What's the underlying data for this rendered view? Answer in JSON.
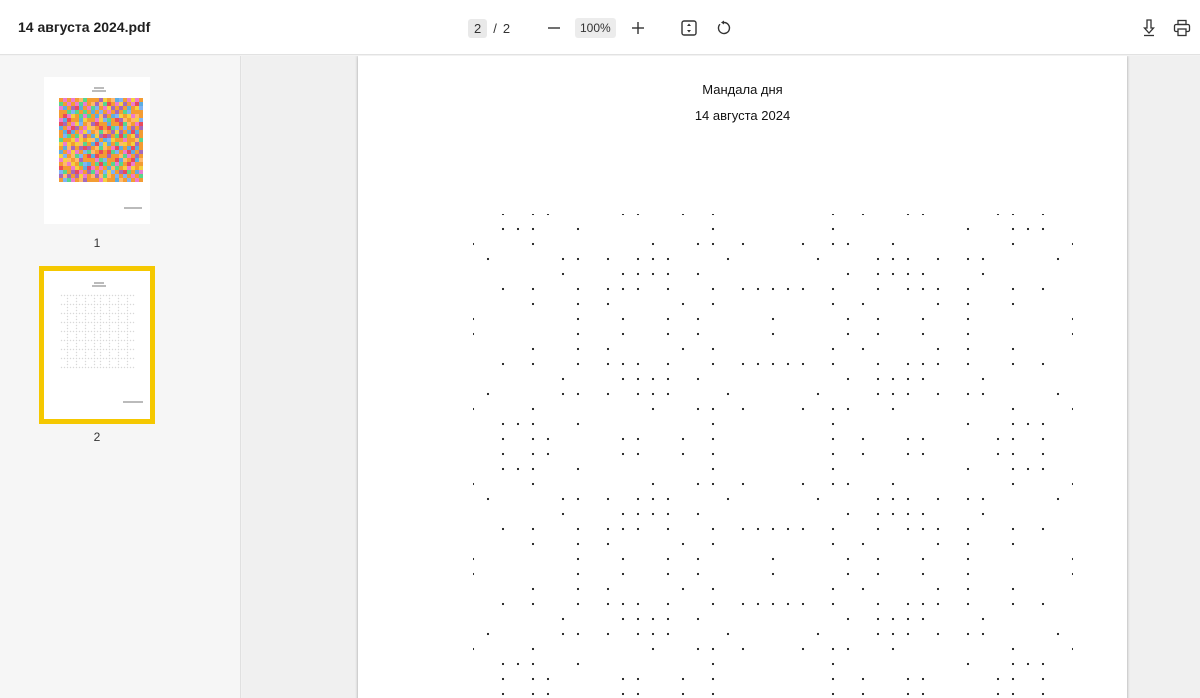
{
  "toolbar": {
    "file_name": "14 августа 2024.pdf",
    "current_page": "2",
    "separator": "/",
    "total_pages": "2",
    "zoom": "100%",
    "icons": [
      "minus-icon",
      "plus-icon",
      "fit-page-icon",
      "rotate-icon",
      "download-icon",
      "print-icon"
    ]
  },
  "sidebar": {
    "thumbnails": [
      {
        "label": "1",
        "selected": false
      },
      {
        "label": "2",
        "selected": true
      }
    ],
    "selection_color": "#f5c800"
  },
  "page": {
    "title": "Мандала дня",
    "date": "14 августа 2024"
  }
}
